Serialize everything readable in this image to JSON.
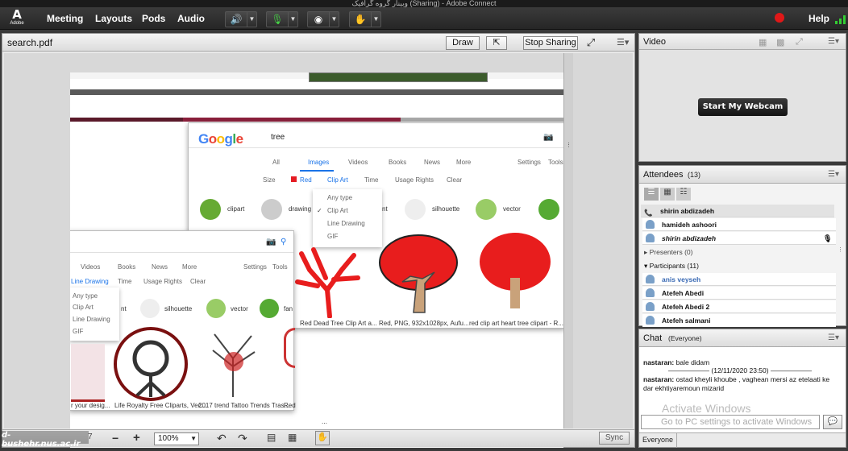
{
  "window": {
    "title": "وبینار گروه گرافیک (Sharing) - Adobe Connect"
  },
  "menubar": {
    "logo": "Adobe",
    "items": [
      "Meeting",
      "Layouts",
      "Pods",
      "Audio"
    ],
    "help": "Help"
  },
  "share": {
    "title": "search.pdf",
    "draw": "Draw",
    "stop": "Stop Sharing",
    "zoom": "100%",
    "sync": "Sync",
    "page_fragment": "7"
  },
  "google_main": {
    "logo": "Google",
    "query": "tree",
    "tabs": [
      "All",
      "Images",
      "Videos",
      "Books",
      "News",
      "More"
    ],
    "settings": "Settings",
    "tools": "Tools",
    "filters": [
      "Size",
      "Red",
      "Clip Art",
      "Time",
      "Usage Rights",
      "Clear"
    ],
    "chips": [
      "clipart",
      "drawing",
      "nt",
      "silhouette",
      "vector"
    ],
    "dropdown": [
      "Any type",
      "Clip Art",
      "Line Drawing",
      "GIF"
    ],
    "captions": [
      "Red Dead Tree Clip Art a...",
      "Red, PNG, 932x1028px, Aufu...",
      "red clip art heart tree clipart - R..."
    ]
  },
  "google_small": {
    "tabs": [
      "Videos",
      "Books",
      "News",
      "More"
    ],
    "settings": "Settings",
    "tools": "Tools",
    "filters": [
      "Line Drawing",
      "Time",
      "Usage Rights",
      "Clear"
    ],
    "dropdown": [
      "Any type",
      "Clip Art",
      "Line Drawing",
      "GIF"
    ],
    "chips": [
      "nt",
      "silhouette",
      "vector",
      "fan"
    ],
    "captions": [
      "r your desig...",
      "Life Royalty Free Cliparts, Vec...",
      "2017 trend Tattoo Trends Tras...",
      "Red"
    ]
  },
  "video": {
    "title": "Video",
    "button": "Start My Webcam"
  },
  "attendees": {
    "title": "Attendees",
    "count": "(13)",
    "hosts": [
      "shirin abdizadeh",
      "hamideh ashoori",
      "shirin abdizadeh"
    ],
    "presenters": "Presenters (0)",
    "participants": "Participants (11)",
    "participant_list": [
      "anis veyseh",
      "Atefeh Abedi",
      "Atefeh Abedi 2",
      "Atefeh salmani"
    ]
  },
  "chat": {
    "title": "Chat",
    "scope": "(Everyone)",
    "messages": [
      {
        "from": "nastaran:",
        "text": "bale didam"
      },
      {
        "sep": "—————— (12/11/2020 23:50) ——————"
      },
      {
        "from": "nastaran:",
        "text": "ostad kheyli khoube , vaghean mersi az etelaati ke dar ekhtiyaremoun mizarid"
      }
    ],
    "watermark": "Activate Windows",
    "input_placeholder": "Go to PC settings to activate Windows",
    "footer": "Everyone"
  },
  "overlay": {
    "university": "d-bushehr.nus.ac.ir"
  },
  "colors": {
    "accent_blue": "#4285f4",
    "record": "#e01818",
    "tree_red": "#e81d1d"
  }
}
